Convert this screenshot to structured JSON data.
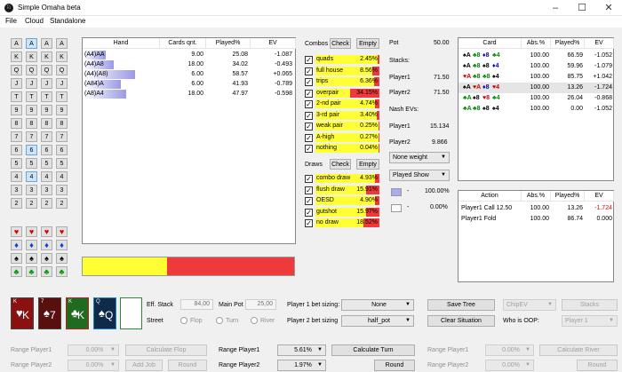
{
  "window": {
    "title": "Simple Omaha beta",
    "icon": "♘"
  },
  "menu": [
    "File",
    "Cloud",
    "Standalone"
  ],
  "ranks": [
    "A",
    "K",
    "Q",
    "J",
    "T",
    "9",
    "8",
    "7",
    "6",
    "5",
    "4",
    "3",
    "2"
  ],
  "hand_table": {
    "headers": [
      "Hand",
      "Cards qnt.",
      "Played%",
      "EV"
    ],
    "rows": [
      {
        "hand": "(A4)AA",
        "qnt": "9.00",
        "played": "25.08",
        "ev": "-1.087",
        "bar": 0.25
      },
      {
        "hand": "(A4)A8",
        "qnt": "18.00",
        "played": "34.02",
        "ev": "-0.493",
        "bar": 0.34
      },
      {
        "hand": "(A4)(A8)",
        "qnt": "6.00",
        "played": "58.57",
        "ev": "+0.065",
        "bar": 0.58
      },
      {
        "hand": "(A84)A",
        "qnt": "6.00",
        "played": "41.93",
        "ev": "-0.789",
        "bar": 0.42
      },
      {
        "hand": "(A8)A4",
        "qnt": "18.00",
        "played": "47.97",
        "ev": "-0.598",
        "bar": 0.48
      }
    ]
  },
  "summary_bar": {
    "yellow_fraction": 0.4,
    "yellow": "#ffff33",
    "red": "#ee3a3a"
  },
  "combos": {
    "label": "Combos",
    "check": "Check",
    "empty": "Empty",
    "items": [
      {
        "name": "quads",
        "value": "2.45%",
        "fraction": 0.0245
      },
      {
        "name": "full house",
        "value": "8.56%",
        "fraction": 0.0856
      },
      {
        "name": "trips",
        "value": "6.36%",
        "fraction": 0.0636
      },
      {
        "name": "overpair",
        "value": "34.15%",
        "fraction": 0.3415
      },
      {
        "name": "2-nd pair",
        "value": "4.74%",
        "fraction": 0.0474
      },
      {
        "name": "3-rd pair",
        "value": "3.40%",
        "fraction": 0.034
      },
      {
        "name": "weak pair",
        "value": "0.25%",
        "fraction": 0.0025
      },
      {
        "name": "A-high",
        "value": "0.27%",
        "fraction": 0.0027
      },
      {
        "name": "nothing",
        "value": "0.04%",
        "fraction": 0.0004
      }
    ]
  },
  "draws": {
    "label": "Draws",
    "check": "Check",
    "empty": "Empty",
    "items": [
      {
        "name": "combo draw",
        "value": "4.93%",
        "fraction": 0.0493
      },
      {
        "name": "flush draw",
        "value": "15.91%",
        "fraction": 0.1591
      },
      {
        "name": "OESD",
        "value": "4.90%",
        "fraction": 0.049
      },
      {
        "name": "gutshot",
        "value": "15.97%",
        "fraction": 0.1597
      },
      {
        "name": "no draw",
        "value": "18.52%",
        "fraction": 0.1852
      }
    ]
  },
  "stats": {
    "pot_label": "Pot",
    "pot": "50.00",
    "stacks_label": "Stacks:",
    "p1_label": "Player1",
    "p1_stack": "71.50",
    "p2_label": "Player2",
    "p2_stack": "71.50",
    "nash_label": "Nash EVs:",
    "p1_ev_label": "Player1",
    "p1_ev": "15.134",
    "p2_ev_label": "Player2",
    "p2_ev": "9.866",
    "weight_select": "None weight",
    "show_select": "Played Show",
    "swatch1_dash": "-",
    "swatch1_pct": "100.00%",
    "swatch2_dash": "-",
    "swatch2_pct": "0.00%"
  },
  "card_table": {
    "headers": [
      "Card",
      "Abs.%",
      "Played%",
      "EV"
    ],
    "rows": [
      {
        "cards": [
          "♠A",
          "♣8",
          "♦8",
          "♣4"
        ],
        "colors": [
          "#000",
          "#080",
          "#00c",
          "#080"
        ],
        "abs": "100.00",
        "played": "66.59",
        "ev": "-1.052",
        "neg": false
      },
      {
        "cards": [
          "♠A",
          "♣8",
          "♠8",
          "♦4"
        ],
        "colors": [
          "#000",
          "#080",
          "#000",
          "#00c"
        ],
        "abs": "100.00",
        "played": "59.96",
        "ev": "-1.079",
        "neg": false
      },
      {
        "cards": [
          "♥A",
          "♣8",
          "♣8",
          "♠4"
        ],
        "colors": [
          "#c00",
          "#080",
          "#080",
          "#000"
        ],
        "abs": "100.00",
        "played": "85.75",
        "ev": "+1.042",
        "neg": false
      },
      {
        "cards": [
          "♠A",
          "♥A",
          "♦8",
          "♥4"
        ],
        "colors": [
          "#000",
          "#c00",
          "#00c",
          "#c00"
        ],
        "abs": "100.00",
        "played": "13.26",
        "ev": "-1.724",
        "neg": false
      },
      {
        "cards": [
          "♣A",
          "♠8",
          "♥8",
          "♣4"
        ],
        "colors": [
          "#080",
          "#000",
          "#c00",
          "#080"
        ],
        "abs": "100.00",
        "played": "26.04",
        "ev": "-0.868",
        "neg": false
      },
      {
        "cards": [
          "♣A",
          "♣8",
          "♠8",
          "♠4"
        ],
        "colors": [
          "#080",
          "#080",
          "#000",
          "#000"
        ],
        "abs": "100.00",
        "played": "0.00",
        "ev": "-1.052",
        "neg": false
      }
    ]
  },
  "action_table": {
    "headers": [
      "Action",
      "Abs.%",
      "Played%",
      "EV"
    ],
    "rows": [
      {
        "action": "Player1 Call 12.50",
        "abs": "100.00",
        "played": "13.26",
        "ev": "-1.724",
        "neg": true
      },
      {
        "action": "Player1 Fold",
        "abs": "100.00",
        "played": "86.74",
        "ev": "0.000",
        "neg": false
      }
    ]
  },
  "board": {
    "cards": [
      {
        "rank": "K",
        "suit": "♥",
        "bg": "#8b1010",
        "border": "#444"
      },
      {
        "rank": "7",
        "suit": "♠",
        "bg": "#5a0f0f",
        "border": "#444"
      },
      {
        "rank": "K",
        "suit": "♣",
        "bg": "#1f6b1f",
        "border": "#b22"
      },
      {
        "rank": "Q",
        "suit": "♠",
        "bg": "#102a4a",
        "border": "#1a7fd6"
      }
    ],
    "empty_slot": ""
  },
  "controls": {
    "eff_stack_label": "Eff. Stack",
    "eff_stack": "84,00",
    "main_pot_label": "Main Pot",
    "main_pot": "25,00",
    "street_label": "Street",
    "flop": "Flop",
    "turn": "Turn",
    "river": "River",
    "p1_sizing_label": "Player 1 bet sizing:",
    "p1_sizing": "None",
    "p2_sizing_label": "Player 2 bet sizing",
    "p2_sizing": "half_pot",
    "save_tree": "Save Tree",
    "clear_situation": "Clear Situation",
    "chip_ev": "ChipEV",
    "stacks": "Stacks",
    "oop_label": "Who is OOP:",
    "oop": "Player 1",
    "range_p1_flop_label": "Range Player1",
    "range_p1_flop": "0.00%",
    "range_p2_flop_label": "Range Player2",
    "range_p2_flop": "0.00%",
    "calculate_flop": "Calculate Flop",
    "add_job": "Add Job",
    "round_flop": "Round",
    "range_p1_turn_label": "Range Player1",
    "range_p1_turn": "5.61%",
    "range_p2_turn_label": "Range Player2",
    "range_p2_turn": "1.97%",
    "calculate_turn": "Calculate Turn",
    "round_turn": "Round",
    "range_p1_river_label": "Range Player1",
    "range_p1_river": "0.00%",
    "range_p2_river_label": "Range Player2",
    "range_p2_river": "0.00%",
    "calculate_river": "Calculate River",
    "round_river": "Round"
  }
}
